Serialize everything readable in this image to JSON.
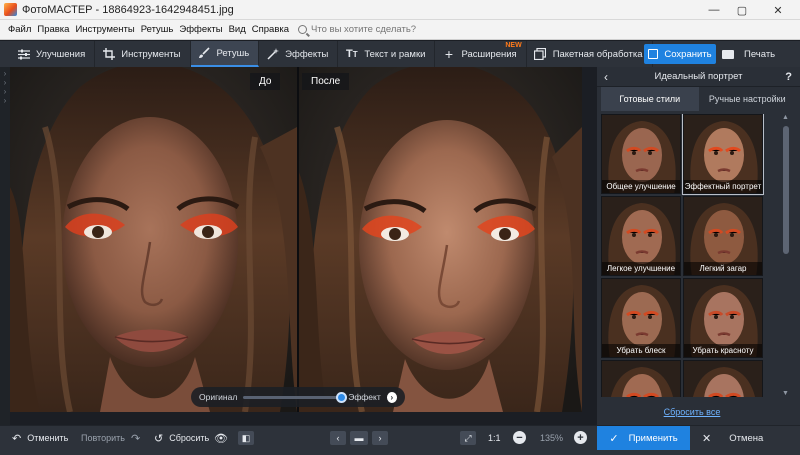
{
  "window": {
    "title": "ФотоМАСТЕР - 18864923-1642948451.jpg",
    "minimize": "—",
    "maximize": "▢",
    "close": "✕"
  },
  "menu": {
    "items": [
      "Файл",
      "Правка",
      "Инструменты",
      "Ретушь",
      "Эффекты",
      "Вид",
      "Справка"
    ],
    "search_placeholder": "Что вы хотите сделать?"
  },
  "toolbar": {
    "tabs": [
      {
        "label": "Улучшения",
        "icon": "sliders-icon"
      },
      {
        "label": "Инструменты",
        "icon": "crop-icon"
      },
      {
        "label": "Ретушь",
        "icon": "brush-icon",
        "active": true
      },
      {
        "label": "Эффекты",
        "icon": "magic-wand-icon"
      },
      {
        "label": "Текст и рамки",
        "icon": "text-icon"
      },
      {
        "label": "Расширения",
        "icon": "plus-icon",
        "badge": "NEW"
      },
      {
        "label": "Пакетная обработка",
        "icon": "batch-icon"
      }
    ],
    "save_label": "Сохранить",
    "print_label": "Печать"
  },
  "canvas": {
    "before_label": "До",
    "after_label": "После",
    "compare": {
      "original_label": "Оригинал",
      "effect_label": "Эффект",
      "slider_value": 1.0
    }
  },
  "panel": {
    "back": "‹",
    "title": "Идеальный портрет",
    "help": "?",
    "tabs": [
      "Готовые стили",
      "Ручные настройки"
    ],
    "active_tab": 0,
    "styles": [
      {
        "label": "Общее улучшение"
      },
      {
        "label": "Эффектный портрет",
        "selected": true
      },
      {
        "label": "Легкое улучшение"
      },
      {
        "label": "Легкий загар"
      },
      {
        "label": "Убрать блеск"
      },
      {
        "label": "Убрать красноту"
      },
      {
        "label": ""
      },
      {
        "label": ""
      }
    ],
    "reset_all": "Сбросить все"
  },
  "bottom": {
    "undo_label": "Отменить",
    "redo_label": "Повторить",
    "reset_label": "Сбросить",
    "zoom_1to1": "1:1",
    "zoom_value": "135%",
    "apply_label": "Применить",
    "cancel_label": "Отмена"
  },
  "colors": {
    "accent": "#1f82e0",
    "toolbar_bg": "#2d323a",
    "panel_bg": "#2a2f37",
    "badge_new": "#ff7a1a"
  }
}
